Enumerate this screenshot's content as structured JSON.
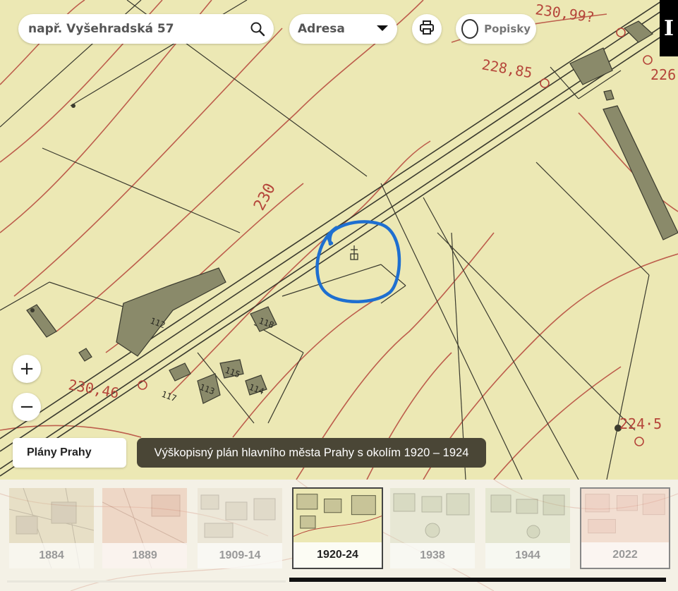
{
  "search": {
    "placeholder": "např. Vyšehradská 57"
  },
  "address_select": {
    "label": "Adresa"
  },
  "labels_toggle": {
    "label": "Popisky"
  },
  "corner_label": "I",
  "zoom": {
    "in": "+",
    "out": "−"
  },
  "layer_button": "Plány Prahy",
  "map_title": "Výškopisný plán hlavního města Prahy s okolím 1920 – 1924",
  "map_text": {
    "c230_997": "230,99?",
    "c228_85": "228,85",
    "c226": "226",
    "c230": "230",
    "c230_46": "230,46",
    "c224_5": "224·5",
    "n112": "112",
    "n118": "118",
    "n117": "117",
    "n113": "113",
    "n115": "115",
    "n114": "114"
  },
  "timeline": [
    {
      "year": "1884",
      "state": "faded"
    },
    {
      "year": "1889",
      "state": "faded"
    },
    {
      "year": "1909-14",
      "state": "faded"
    },
    {
      "year": "1920-24",
      "state": "active"
    },
    {
      "year": "1938",
      "state": "faded"
    },
    {
      "year": "1944",
      "state": "faded"
    },
    {
      "year": "2022",
      "state": "faded"
    }
  ],
  "colors": {
    "paper": "#ece8b4",
    "contour": "#b5453a",
    "ink": "#3a3a2e",
    "marker": "#1e6fd0",
    "building": "#8a8a6a"
  }
}
